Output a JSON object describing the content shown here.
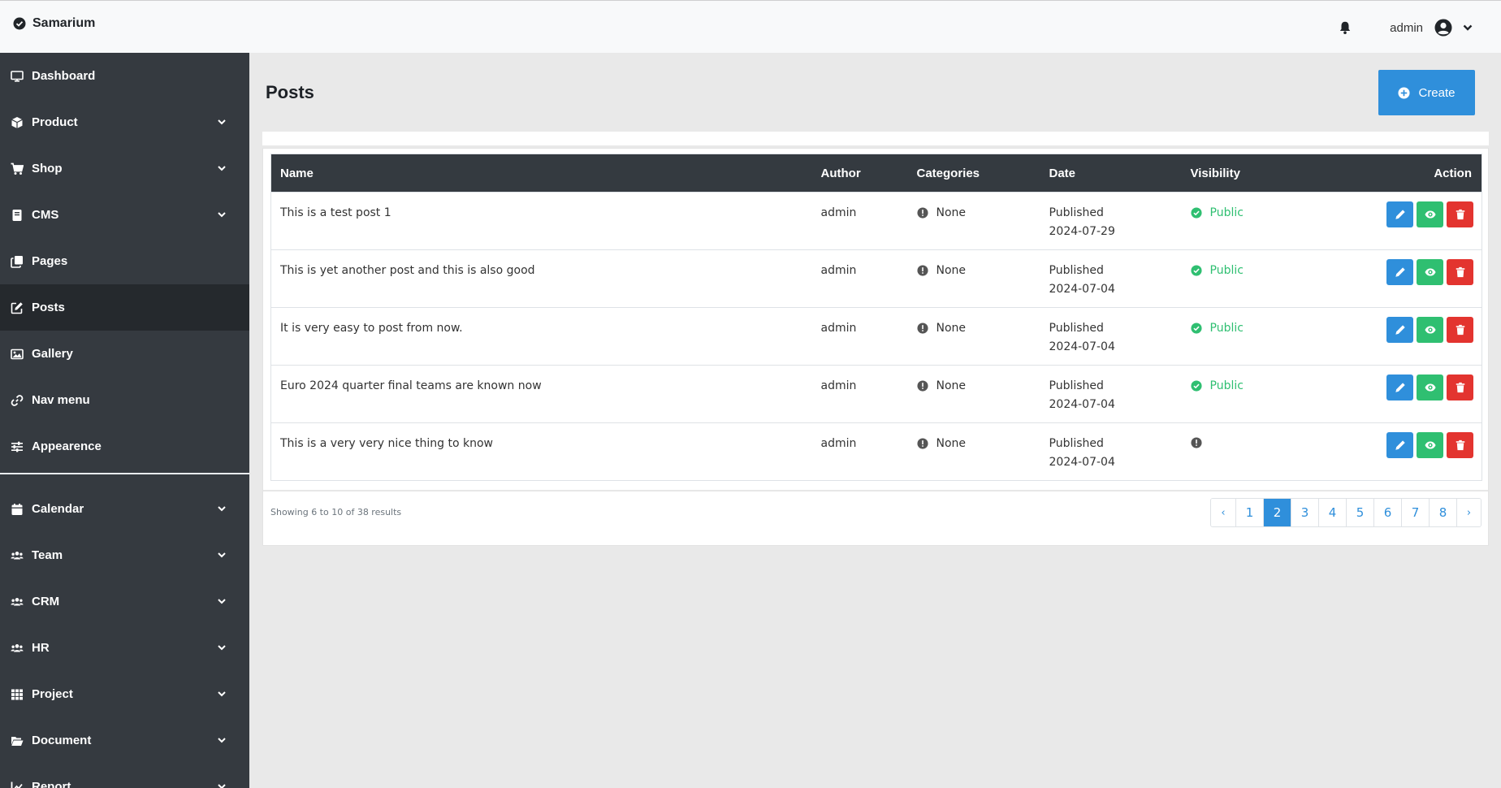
{
  "app": {
    "brand": "Samarium"
  },
  "header": {
    "user": "admin"
  },
  "sidebar": {
    "items": [
      {
        "label": "Dashboard",
        "icon": "desktop-icon",
        "chevron": false,
        "active": false
      },
      {
        "label": "Product",
        "icon": "cube-icon",
        "chevron": true,
        "active": false
      },
      {
        "label": "Shop",
        "icon": "cart-icon",
        "chevron": true,
        "active": false
      },
      {
        "label": "CMS",
        "icon": "book-icon",
        "chevron": true,
        "active": false
      },
      {
        "label": "Pages",
        "icon": "copy-icon",
        "chevron": false,
        "active": false
      },
      {
        "label": "Posts",
        "icon": "edit-icon",
        "chevron": false,
        "active": true
      },
      {
        "label": "Gallery",
        "icon": "image-icon",
        "chevron": false,
        "active": false
      },
      {
        "label": "Nav menu",
        "icon": "link-icon",
        "chevron": false,
        "active": false
      },
      {
        "label": "Appearence",
        "icon": "sliders-icon",
        "chevron": false,
        "active": false
      }
    ],
    "items2": [
      {
        "label": "Calendar",
        "icon": "calendar-icon",
        "chevron": true
      },
      {
        "label": "Team",
        "icon": "users-icon",
        "chevron": true
      },
      {
        "label": "CRM",
        "icon": "users-icon",
        "chevron": true
      },
      {
        "label": "HR",
        "icon": "users-icon",
        "chevron": true
      },
      {
        "label": "Project",
        "icon": "grid-icon",
        "chevron": true
      },
      {
        "label": "Document",
        "icon": "folder-icon",
        "chevron": true
      },
      {
        "label": "Report",
        "icon": "chart-icon",
        "chevron": true
      }
    ]
  },
  "main": {
    "title": "Posts",
    "create_label": "Create",
    "table": {
      "columns": [
        "Name",
        "Author",
        "Categories",
        "Date",
        "Visibility",
        "Action"
      ],
      "rows": [
        {
          "name": "This is a test post 1",
          "author": "admin",
          "category": "None",
          "status": "Published",
          "date": "2024-07-29",
          "visibility": "Public"
        },
        {
          "name": "This is yet another post and this is also good",
          "author": "admin",
          "category": "None",
          "status": "Published",
          "date": "2024-07-04",
          "visibility": "Public"
        },
        {
          "name": "It is very easy to post from now.",
          "author": "admin",
          "category": "None",
          "status": "Published",
          "date": "2024-07-04",
          "visibility": "Public"
        },
        {
          "name": "Euro 2024 quarter final teams are known now",
          "author": "admin",
          "category": "None",
          "status": "Published",
          "date": "2024-07-04",
          "visibility": "Public"
        },
        {
          "name": "This is a very very nice thing to know",
          "author": "admin",
          "category": "None",
          "status": "Published",
          "date": "2024-07-04",
          "visibility": ""
        }
      ]
    },
    "showing_text": "Showing 6 to 10 of 38 results",
    "pagination": {
      "prev": "‹",
      "pages": [
        "1",
        "2",
        "3",
        "4",
        "5",
        "6",
        "7",
        "8"
      ],
      "current": "2",
      "next": "›"
    }
  },
  "colors": {
    "sidebar": "#353a40",
    "primary": "#2f8fdb",
    "success": "#2fbf71",
    "danger": "#e3342f"
  }
}
